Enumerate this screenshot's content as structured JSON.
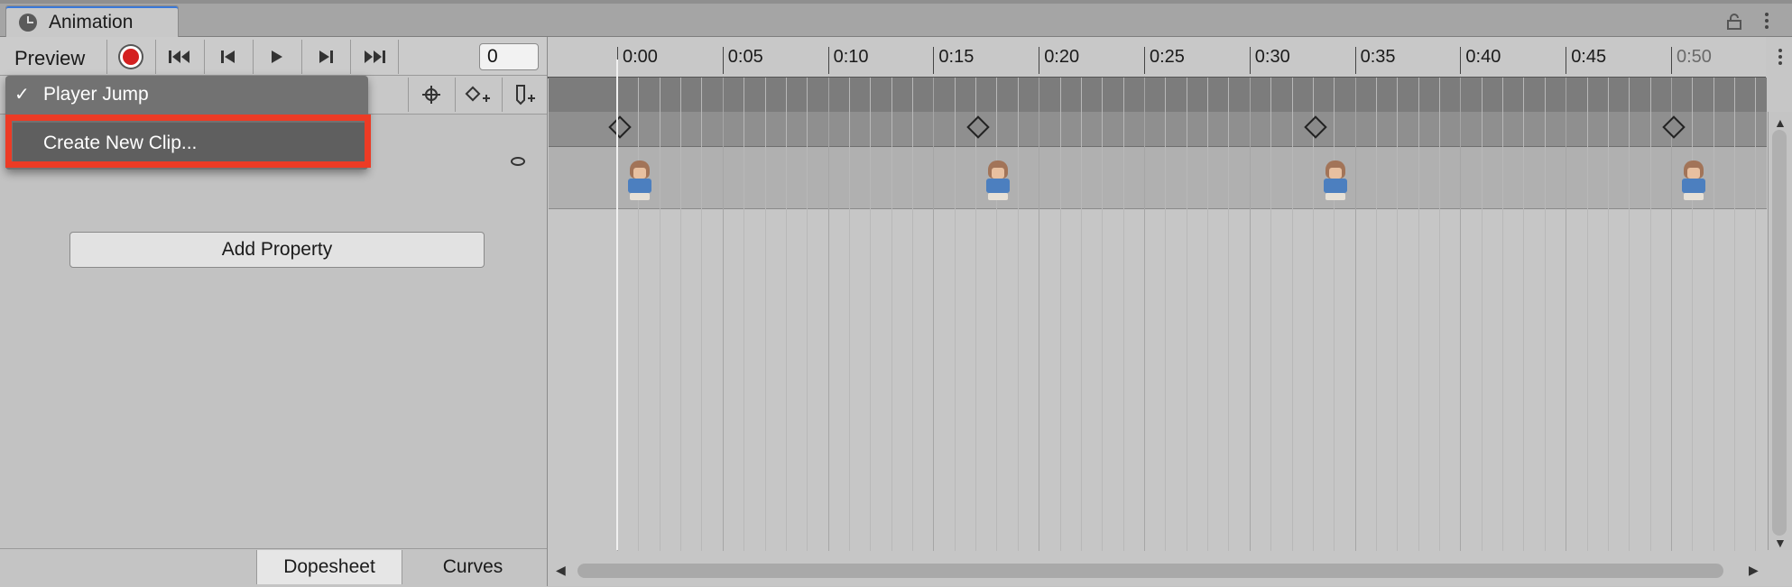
{
  "window": {
    "tab_title": "Animation",
    "lock_icon": "lock-icon",
    "menu_icon": "kebab-menu-icon"
  },
  "toolbar": {
    "preview_label": "Preview",
    "frame_value": "0",
    "icons": [
      "record-icon",
      "first-key-icon",
      "prev-key-icon",
      "play-icon",
      "next-key-icon",
      "last-key-icon"
    ]
  },
  "clip_dropdown": {
    "items": [
      {
        "label": "Player Jump",
        "checked": true,
        "check_glyph": "✓"
      },
      {
        "label": "Create New Clip...",
        "checked": false
      }
    ],
    "highlight_color": "#ec3b25"
  },
  "properties": {
    "add_property_label": "Add Property"
  },
  "view_tabs": {
    "dopesheet": "Dopesheet",
    "curves": "Curves",
    "active": "Dopesheet"
  },
  "timeline": {
    "ticks": [
      "0:00",
      "0:05",
      "0:10",
      "0:15",
      "0:20",
      "0:25",
      "0:30",
      "0:35",
      "0:40",
      "0:45",
      "0:50"
    ],
    "keyframes_at": [
      "0:00",
      "0:17",
      "0:33",
      "0:50"
    ],
    "playhead_at": "0:00"
  }
}
